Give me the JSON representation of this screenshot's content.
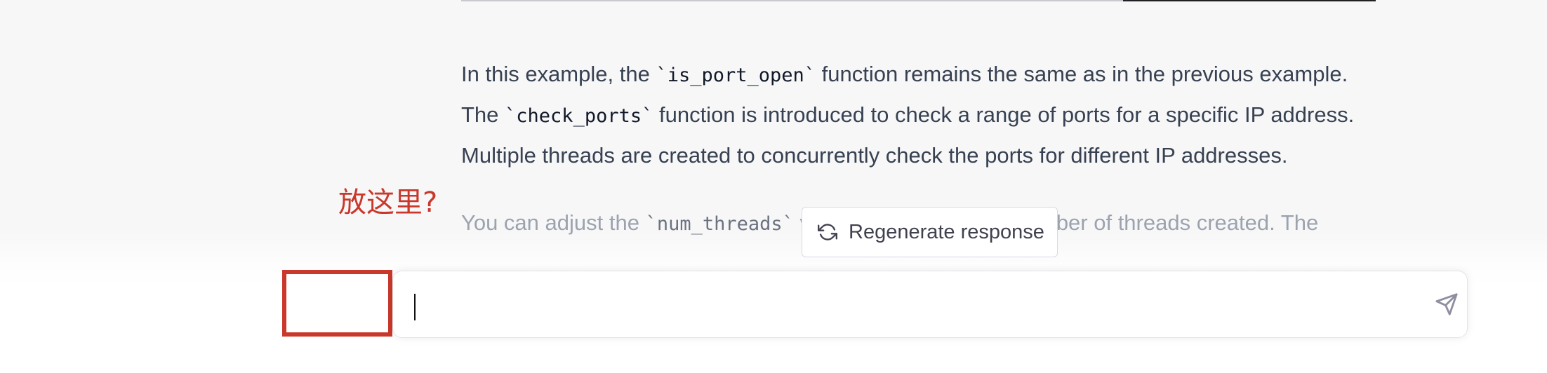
{
  "conversation": {
    "paragraph_1": {
      "t1": "In this example, the ",
      "c1": "`is_port_open`",
      "t2": " function remains the same as in the previous example. The ",
      "c2": "`check_ports`",
      "t3": " function is introduced to check a range of ports for a specific IP address. Multiple threads are created to concurrently check the ports for different IP addresses."
    },
    "paragraph_2": {
      "t1": "You can adjust the ",
      "c1": "`num_threads`",
      "t2": " variable to control the number of threads created. The"
    }
  },
  "annotation": {
    "label": "放这里?",
    "color": "#c9382b"
  },
  "regenerate": {
    "label": "Regenerate response",
    "icon": "refresh-icon"
  },
  "composer": {
    "value": "",
    "send_icon": "paper-plane-icon"
  }
}
